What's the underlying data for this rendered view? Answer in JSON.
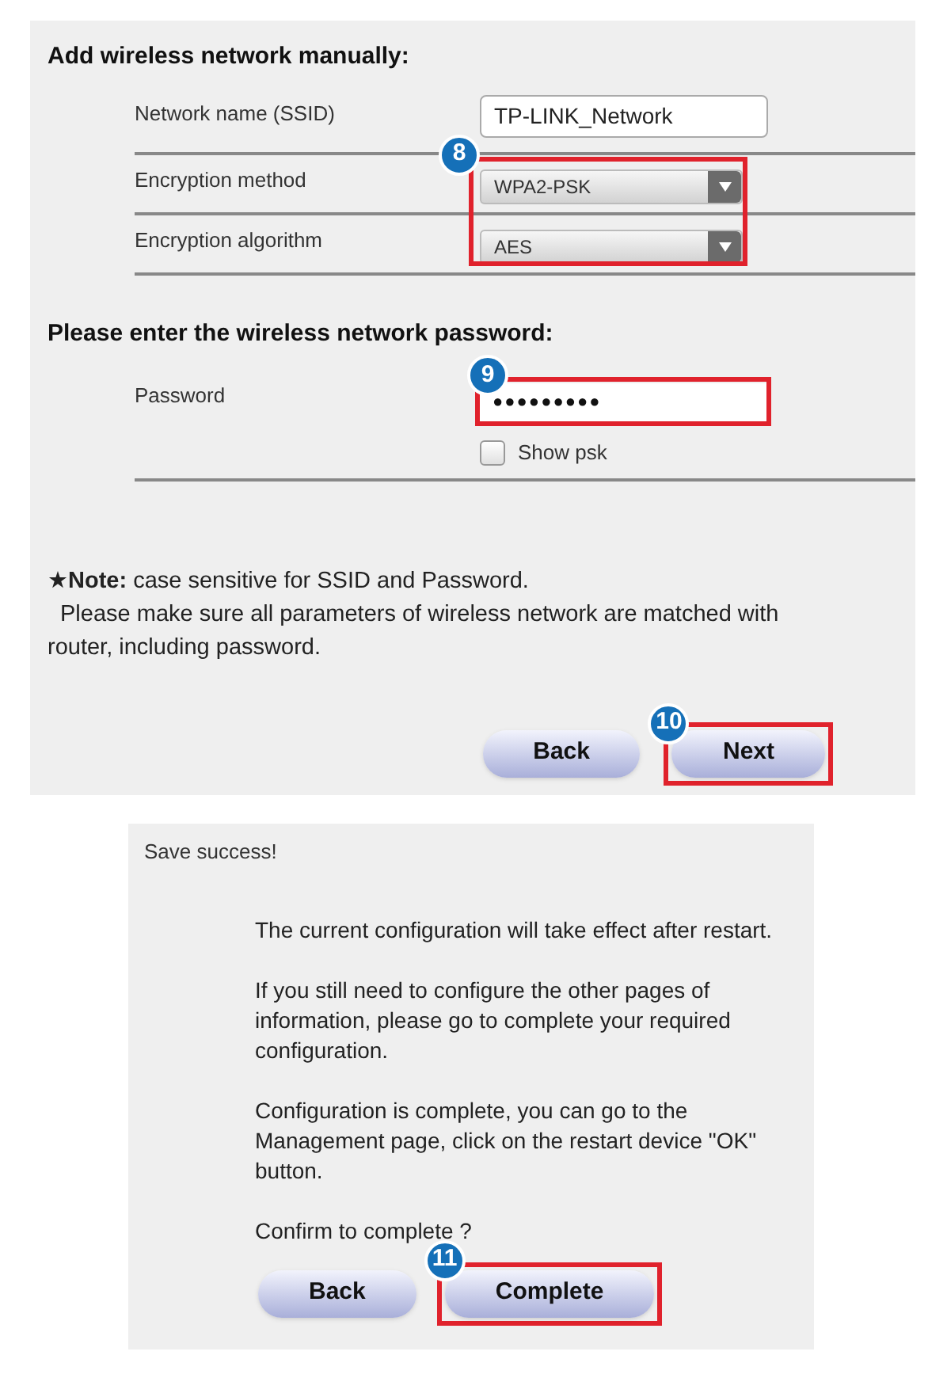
{
  "wifi_form": {
    "heading": "Add wireless network manually:",
    "ssid": {
      "label": "Network name (SSID)",
      "value": "TP-LINK_Network"
    },
    "encryption": {
      "callout": "8",
      "highlighted": true,
      "fields": [
        {
          "label": "Encryption method",
          "value": "WPA2-PSK"
        },
        {
          "label": "Encryption algorithm",
          "value": "AES"
        }
      ]
    },
    "password_heading": "Please enter the wireless network password:",
    "password": {
      "label": "Password",
      "value": "●●●●●●●●●",
      "callout": "9",
      "highlighted": true
    },
    "show_psk": {
      "label": "Show psk",
      "checked": false
    },
    "note": {
      "text": "★**Note:** case sensitive for SSID and Password.",
      "detail": "Please make sure all parameters of wireless network are matched with router,  including password."
    },
    "buttons": [
      {
        "label": "Back",
        "highlighted": false
      },
      {
        "label": "Next",
        "highlighted": true,
        "callout": "10"
      }
    ]
  },
  "save_dialog": {
    "title": "Save success!",
    "paragraphs": [
      "The current configuration will take effect after restart.",
      "If you still need to configure the other pages of information,  please go to complete your required configuration.",
      "Configuration is complete,  you can go to the Management page,  click on the restart device \"OK\" button."
    ],
    "confirm": "Confirm to complete ?",
    "buttons": [
      {
        "label": "Back",
        "highlighted": false
      },
      {
        "label": "Complete",
        "highlighted": true,
        "callout": "11"
      }
    ]
  }
}
